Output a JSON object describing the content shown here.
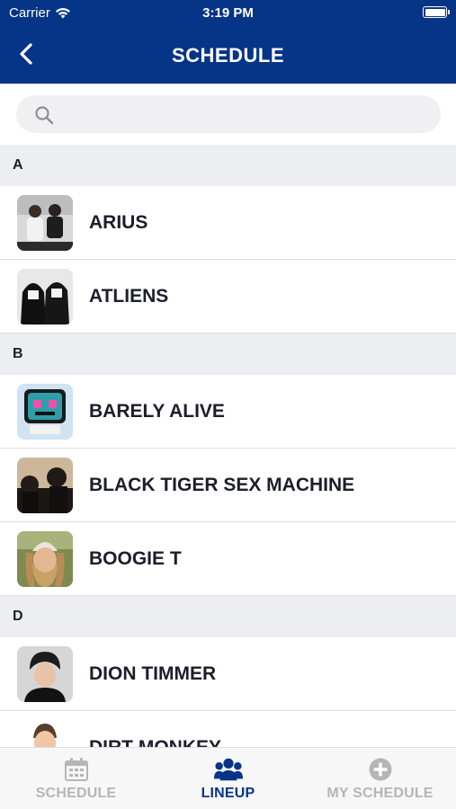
{
  "status_bar": {
    "carrier": "Carrier",
    "time": "3:19 PM"
  },
  "nav": {
    "title": "SCHEDULE"
  },
  "search": {
    "placeholder": ""
  },
  "sections": [
    {
      "letter": "A",
      "artists": [
        "ARIUS",
        "ATLIENS"
      ]
    },
    {
      "letter": "B",
      "artists": [
        "BARELY ALIVE",
        "BLACK TIGER SEX MACHINE",
        "BOOGIE T"
      ]
    },
    {
      "letter": "D",
      "artists": [
        "DION TIMMER",
        "DIRT MONKEY"
      ]
    }
  ],
  "tabs": [
    {
      "label": "SCHEDULE",
      "icon": "calendar-icon",
      "active": false
    },
    {
      "label": "LINEUP",
      "icon": "group-icon",
      "active": true
    },
    {
      "label": "MY SCHEDULE",
      "icon": "plus-circle-icon",
      "active": false
    }
  ],
  "colors": {
    "brand": "#063487",
    "section_bg": "#eceef1",
    "inactive_tab": "#b5b5b8"
  }
}
